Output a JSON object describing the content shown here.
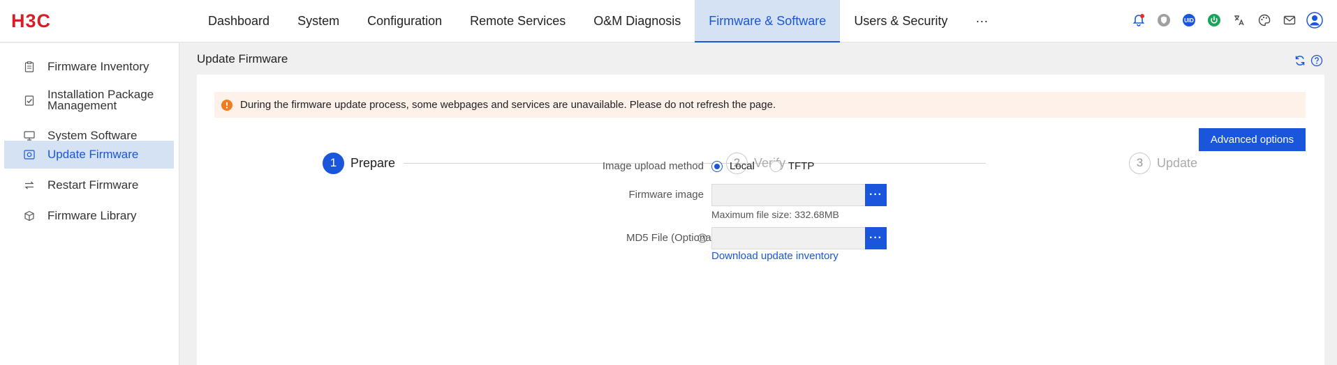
{
  "brand": {
    "logo_text": "H3C",
    "logo_color": "#d32027"
  },
  "nav": {
    "items": [
      {
        "label": "Dashboard"
      },
      {
        "label": "System"
      },
      {
        "label": "Configuration"
      },
      {
        "label": "Remote Services"
      },
      {
        "label": "O&M Diagnosis"
      },
      {
        "label": "Firmware & Software",
        "active": true
      },
      {
        "label": "Users & Security"
      },
      {
        "label": "···"
      }
    ]
  },
  "toolbar_icons": [
    "bell-icon",
    "shield-icon",
    "uid-icon",
    "power-icon",
    "language-icon",
    "palette-icon",
    "mail-icon",
    "user-avatar-icon"
  ],
  "uid_text": "UID",
  "sidebar": {
    "items": [
      {
        "label": "Firmware Inventory",
        "icon": "inventory-icon"
      },
      {
        "label": "Installation Package Management",
        "icon": "package-icon"
      },
      {
        "label": "System Software",
        "icon": "monitor-icon"
      },
      {
        "label": "Update Firmware",
        "icon": "update-icon",
        "active": true
      },
      {
        "label": "Restart Firmware",
        "icon": "restart-icon"
      },
      {
        "label": "Firmware Library",
        "icon": "library-icon"
      }
    ]
  },
  "page": {
    "title": "Update Firmware"
  },
  "alert": {
    "text": "During the firmware update process, some webpages and services are unavailable. Please do not refresh the page.",
    "color": "#f07c21"
  },
  "advanced_options_label": "Advanced options",
  "steps": [
    {
      "number": "1",
      "label": "Prepare",
      "active": true
    },
    {
      "number": "2",
      "label": "Verify"
    },
    {
      "number": "3",
      "label": "Update"
    }
  ],
  "form": {
    "upload_method_label": "Image upload method",
    "upload_options": [
      {
        "label": "Local",
        "checked": true
      },
      {
        "label": "TFTP",
        "checked": false
      }
    ],
    "firmware_image_label": "Firmware image",
    "firmware_image_value": "",
    "max_size_hint": "Maximum file size: 332.68MB",
    "md5_label": "MD5 File (Optional)",
    "md5_value": "",
    "browse_label": "···",
    "download_link": "Download update inventory"
  },
  "accent_color": "#1a56db"
}
